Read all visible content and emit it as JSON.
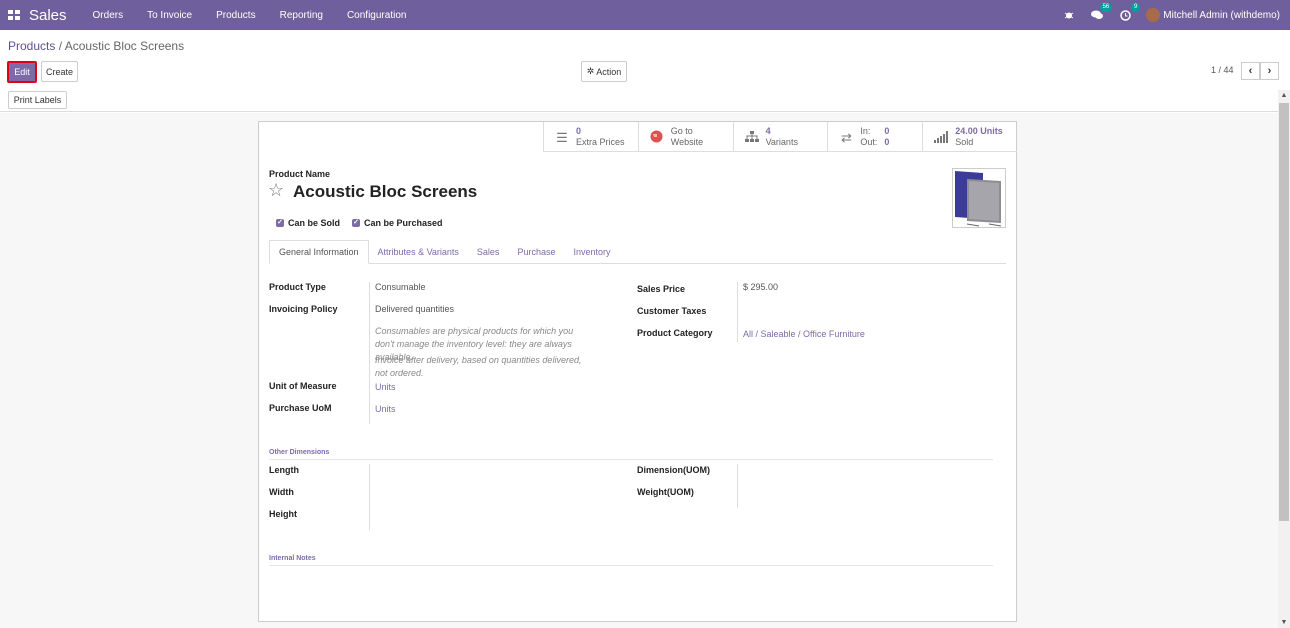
{
  "navbar": {
    "app_name": "Sales",
    "menu": [
      "Orders",
      "To Invoice",
      "Products",
      "Reporting",
      "Configuration"
    ],
    "messages_count": "56",
    "activities_count": "9",
    "user_name": "Mitchell Admin (withdemo)"
  },
  "breadcrumb": {
    "parent": "Products",
    "separator": "/",
    "current": "Acoustic Bloc Screens"
  },
  "controls": {
    "edit": "Edit",
    "create": "Create",
    "action": "Action",
    "pager": "1 / 44",
    "print_labels": "Print Labels"
  },
  "stats": {
    "extra_prices_count": "0",
    "extra_prices_label": "Extra Prices",
    "website_line1": "Go to",
    "website_line2": "Website",
    "variants_count": "4",
    "variants_label": "Variants",
    "in_label": "In:",
    "in_value": "0",
    "out_label": "Out:",
    "out_value": "0",
    "sold_value": "24.00 Units",
    "sold_label": "Sold"
  },
  "product": {
    "name_label": "Product Name",
    "name": "Acoustic Bloc Screens",
    "can_be_sold": "Can be Sold",
    "can_be_purchased": "Can be Purchased"
  },
  "tabs": [
    "General Information",
    "Attributes & Variants",
    "Sales",
    "Purchase",
    "Inventory"
  ],
  "general": {
    "product_type_label": "Product Type",
    "product_type": "Consumable",
    "invoicing_policy_label": "Invoicing Policy",
    "invoicing_policy": "Delivered quantities",
    "help_consumable": "Consumables are physical products for which you don't manage the inventory level: they are always available.",
    "help_invoice": "Invoice after delivery, based on quantities delivered, not ordered.",
    "uom_label": "Unit of Measure",
    "uom": "Units",
    "purchase_uom_label": "Purchase UoM",
    "purchase_uom": "Units",
    "sales_price_label": "Sales Price",
    "sales_price": "$ 295.00",
    "customer_taxes_label": "Customer Taxes",
    "category_label": "Product Category",
    "category": "All / Saleable / Office Furniture"
  },
  "dimensions": {
    "section": "Other Dimensions",
    "length": "Length",
    "width": "Width",
    "height": "Height",
    "dimension_uom": "Dimension(UOM)",
    "weight_uom": "Weight(UOM)"
  },
  "notes": {
    "section": "Internal Notes"
  },
  "colors": {
    "navbar": "#6f5f9c",
    "accent": "#7c6ba7",
    "highlight": "#e0001a"
  }
}
